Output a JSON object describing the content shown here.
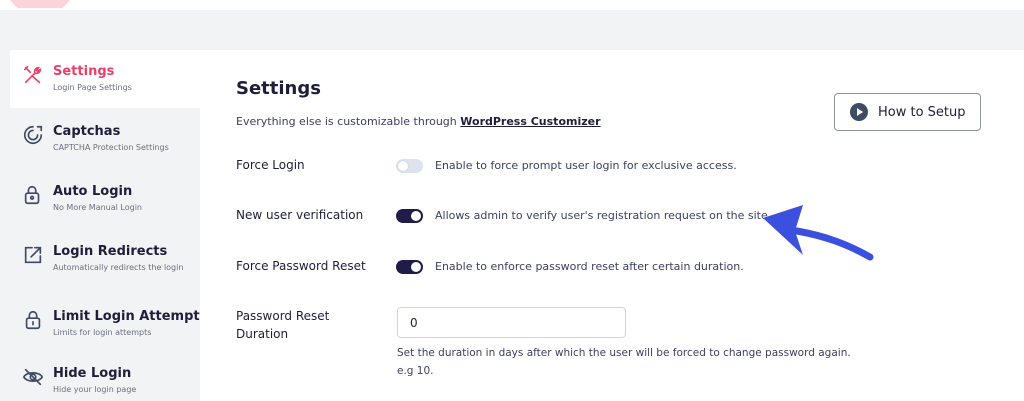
{
  "sidebar": {
    "items": [
      {
        "title": "Settings",
        "subtitle": "Login Page Settings",
        "icon": "tools-icon",
        "active": true
      },
      {
        "title": "Captchas",
        "subtitle": "CAPTCHA Protection Settings",
        "icon": "captcha-icon"
      },
      {
        "title": "Auto Login",
        "subtitle": "No More Manual Login",
        "icon": "lock-user-icon"
      },
      {
        "title": "Login Redirects",
        "subtitle": "Automatically redirects the login",
        "icon": "external-link-icon"
      },
      {
        "title": "Limit Login Attempts",
        "subtitle": "Limits for login attempts",
        "icon": "padlock-icon"
      },
      {
        "title": "Hide Login",
        "subtitle": "Hide your login page",
        "icon": "eye-off-icon"
      }
    ]
  },
  "main": {
    "title": "Settings",
    "intro_text": "Everything else is customizable through ",
    "intro_link": "WordPress Customizer",
    "how_button": "How to Setup",
    "rows": [
      {
        "label": "Force Login",
        "enabled": false,
        "description": "Enable to force prompt user login for exclusive access."
      },
      {
        "label": "New user verification",
        "enabled": true,
        "description": "Allows admin to verify user's registration request on the site."
      },
      {
        "label": "Force Password Reset",
        "enabled": true,
        "description": "Enable to enforce password reset after certain duration."
      }
    ],
    "duration": {
      "label": "Password Reset Duration",
      "value": "0",
      "help": "Set the duration in days after which the user will be forced to change password again. e.g 10."
    }
  },
  "colors": {
    "accent": "#e8426a",
    "toggle_on": "#1f1d47",
    "arrow": "#3c50e0"
  }
}
